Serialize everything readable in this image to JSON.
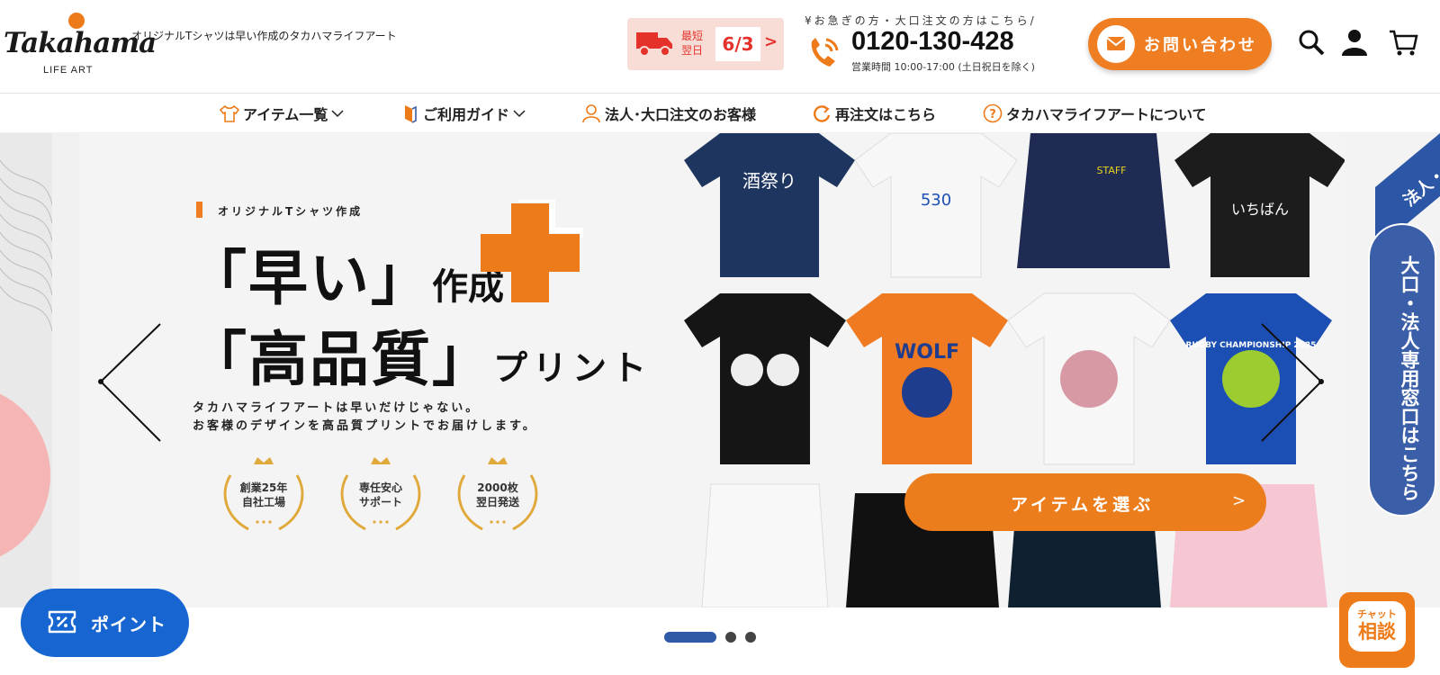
{
  "header": {
    "logo_word": "Takahama",
    "logo_sub": "LIFE ART",
    "tagline": "オリジナルTシャツは早い作成のタカハマライフアート",
    "delivery_label": "最短翌日",
    "delivery_date": "6/3",
    "delivery_arrow": ">",
    "phone_note": "¥お急ぎの方・大口注文の方はこちら/",
    "phone_number": "0120-130-428",
    "phone_hours": "営業時間 10:00-17:00 (土日祝日を除く)",
    "contact_label": "お問い合わせ",
    "icons": [
      "truck-icon",
      "phone-icon",
      "mail-icon",
      "search-icon",
      "user-icon",
      "cart-icon"
    ]
  },
  "nav": {
    "items": [
      {
        "label": "アイテム一覧",
        "icon": "tshirt-icon"
      },
      {
        "label": "ご利用ガイド",
        "icon": "guide-icon"
      },
      {
        "label": "法人･大口注文のお客様",
        "icon": "person-icon"
      },
      {
        "label": "再注文はこちら",
        "icon": "reorder-icon"
      },
      {
        "label": "タカハマライフアートについて",
        "icon": "question-icon"
      }
    ]
  },
  "hero": {
    "eyebrow": "オリジナルTシャツ作成",
    "line1_open": "「早い」",
    "line1_tail": "作成",
    "line2_open": "「高品質」",
    "line2_tail": "プリント",
    "intro_1": "タカハマライフアートは早いだけじゃない。",
    "intro_2": "お客様のデザインを高品質プリントでお届けします。",
    "awards": [
      {
        "line1": "創業25年",
        "line2": "自社工場"
      },
      {
        "line1": "専任安心",
        "line2": "サポート"
      },
      {
        "line1": "2000枚",
        "line2": "翌日発送"
      }
    ],
    "cta_label": "アイテムを選ぶ",
    "cta_arrow": ">",
    "shirts": [
      {
        "color": "#1e3560",
        "print": "酒祭り"
      },
      {
        "color": "#f7f7f7",
        "print": "530"
      },
      {
        "color": "#1f2b52",
        "print": "STAFF"
      },
      {
        "color": "#1c1c1c",
        "print": "いちばん"
      },
      {
        "color": "#151515",
        "print": ""
      },
      {
        "color": "#ef7a22",
        "print": "WOLF"
      },
      {
        "color": "#f7f7f7",
        "print": ""
      },
      {
        "color": "#1c4fb3",
        "print": "RUGBY CHAMPIONSHIP 2025"
      }
    ],
    "corp_banner": "大口・法人専用窓口はこちら",
    "corp_ribbon": "法人・"
  },
  "slider": {
    "active": 1,
    "total": 3
  },
  "point_button": "ポイント",
  "chat": {
    "line1": "チャット",
    "line2": "相談"
  },
  "colors": {
    "accent": "#ee7b1a",
    "brand_blue": "#1665d1",
    "red": "#e4322b",
    "navy": "#3b5ea8"
  }
}
